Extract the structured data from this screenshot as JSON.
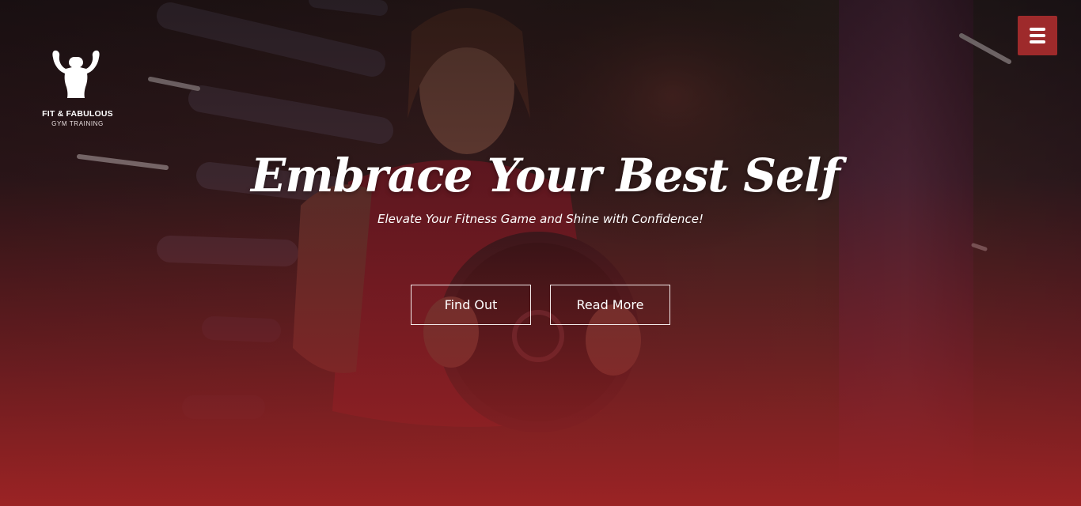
{
  "brand": {
    "name": "FIT & FABULOUS",
    "tagline": "GYM TRAINING"
  },
  "hero": {
    "headline": "Embrace Your Best Self",
    "subheadline": "Elevate Your Fitness Game and Shine with Confidence!"
  },
  "actions": {
    "find_out": "Find Out",
    "read_more": "Read More"
  },
  "icons": {
    "menu": "hamburger-menu-icon",
    "logo": "bodybuilder-flex-icon"
  },
  "colors": {
    "accent": "#9e2a2b",
    "bottom_gradient": "#9b2324",
    "text": "#ffffff"
  }
}
